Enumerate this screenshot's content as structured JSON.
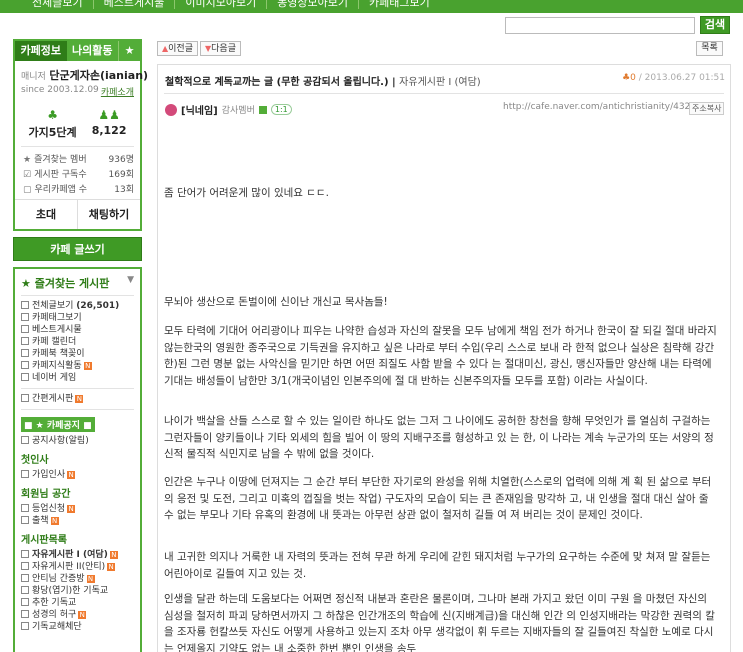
{
  "top_tabs": [
    "전체글보기",
    "베스트게시물",
    "이미지모아보기",
    "동영상모아보기",
    "카페태그보기"
  ],
  "search": {
    "value": "",
    "button": "검색"
  },
  "cafe_info": {
    "tab_info": "카페정보",
    "tab_activity": "나의활동",
    "tab_star": "★",
    "manager_label": "매니저",
    "manager_name": "단군게자손(ianian)",
    "since": "since 2003.12.09",
    "intro_link": "카페소개",
    "level_name": "가지5단계",
    "member_count": "8,122",
    "counts": [
      {
        "label": "즐겨찾는 멤버",
        "value": "936명"
      },
      {
        "label": "게시판 구독수",
        "value": "169회"
      },
      {
        "label": "우리카페앱 수",
        "value": "13회"
      }
    ],
    "invite_btn": "초대",
    "chat_btn": "채팅하기"
  },
  "write_btn": "카페 글쓰기",
  "menu": {
    "fav_title": "즐겨찾는 게시판",
    "items_top": [
      "전체글보기",
      "카페태그보기",
      "베스트게시물",
      "카페 캘린더",
      "카페북 책꽂이",
      "카페지식활동",
      "네이버 게임"
    ],
    "total_count": "(26,501)",
    "simple_board": "간편게시판",
    "notice_title": "카페공지",
    "notice_item": "공지사항(알림)",
    "group1": "첫인사",
    "group1_items": [
      "가입인사"
    ],
    "group2": "회원님 공간",
    "group2_items": [
      "등업신청",
      "출책"
    ],
    "group3": "게시판목록",
    "group3_items": [
      "자유게시판 I (여담)",
      "자유게시판 II(안티)",
      "안티님 간증방",
      "황당(엽기)한 기독교",
      "추한 기독교",
      "성경의 허구"
    ],
    "more_item": "기독교해체단"
  },
  "nav": {
    "prev": "이전글",
    "next": "다음글",
    "list": "목록"
  },
  "post": {
    "title": "철학적으로 계독교까는 글 (무한 공감되서 올립니다.)",
    "board": "자유게시판 I (여담)",
    "date": "2013.06.27 01:51",
    "author_nick": "[닉네임]",
    "grade": "감사멤버",
    "talk": "1:1",
    "url": "http://cafe.naver.com/antichristianity/43247",
    "copy_btn": "주소복사",
    "lines": [
      "좀 단어가 어려운게 많이 있네요 ㄷㄷ.",
      "무뇌아 생산으로 돈벌이에 신이난 개신교 목사놈들!",
      "모두 타력에 기대어 어리광이나 피우는 나약한 습성과 자신의 잘못을 모두 남에게 책임 전가 하거나 한국이 잘 되길 절대 바라지 않는한국의 영원한 종주국으로 기득권을 유지하고 싶은 나라로 부터 수입(우리 스스로 보내 라 한적 없으나 실상은 침략해 강간 한)된 그런 명분 없는 사악신을 믿기만 하면 어떤 죄질도 사함 받을 수 있다 는 절대미신, 광신, 맹신자들만 양산해 내는 타력에 기대는 배성들이 남한만 3/1(개국이념인 인본주의에 절 대 반하는 신본주의자들 모두를 포함) 이라는 사실이다.",
      "나이가 백살을 산들 스스로 할 수 있는 일이란 하나도 없는 그저 그 나이에도 공허한 창천을 향해 무엇인가 를 열심히 구걸하는 그런자들이 양키들이나 기타 외세의 힘을 빌어 이 땅의 지배구조를 형성하고 있 는 한, 이 나라는 계속 누군가의 또는 서양의 정신적 물직적 식민지로 남을 수 밖에 없을 것이다.",
      "인간은 누구나 이땅에 던져지는 그 순간 부터 부단한 자기로의 완성을 위해 치열한(스스로의 업력에 의해 계 획 된 삶으로 부터의 응전 및 도전, 그리고 미혹의 껍질을 벗는 작업) 구도자의 모습이 되는 큰 존재임을 망각하 고, 내 인생을 절대 대신 살아 줄 수 없는 부모나 기타 유혹의 환경에 내 뜻과는 아무런 상관 없이 철저히 길들 여 져 버리는 것이 문제인 것이다.",
      "내 고귀한 의지나 거룩한 내 자력의 뜻과는 전혀 무관 하게 우리에 갇힌 돼지처럼 누구가의 요구하는 수준에 맞 쳐져 말 잘듣는 어린아이로 길들여 지고 있는 것.",
      "인생을 달관 하는데 도움보다는 어쩌면 정신적 내분과 혼란은 물론이며, 그나마 본래 가지고 왔던 이미 구원 을 마쳤던 자신의 심성을 철저히 파괴 당하면서까지 그 하찮은 인간개조의 학습에 신(지배계급)을 대신해 인간 의 인성지배라는 막강한 권력의 칼을 조자룡 헌칼쓰듯 자신도 어떻게 사용하고 있는지 조차 아무 생각없이 휘 두르는 지배자들의 잘 길들여진 착실한 노예로 다시는 언제올지 기약도 없는 내 소중한 한번 뿐인 인생을 송두"
    ]
  },
  "colors": {
    "brand_green": "#49a22f",
    "dark_green": "#2f7d18",
    "new_badge": "#f07a2e"
  }
}
